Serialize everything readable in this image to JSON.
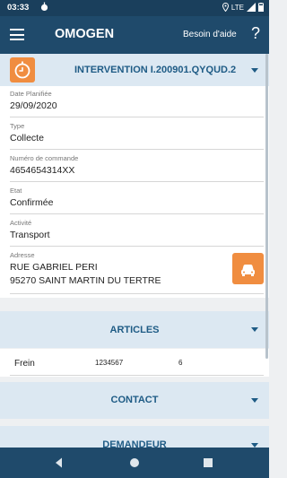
{
  "statusbar": {
    "time": "03:33",
    "network": "LTE"
  },
  "appbar": {
    "title": "OMOGEN",
    "help_label": "Besoin d'aide",
    "help_icon": "?"
  },
  "intervention": {
    "title": "INTERVENTION I.200901.QYQUD.2",
    "fields": [
      {
        "label": "Date Planifiée",
        "value": "29/09/2020"
      },
      {
        "label": "Type",
        "value": "Collecte"
      },
      {
        "label": "Numéro de commande",
        "value": "4654654314XX"
      },
      {
        "label": "Etat",
        "value": "Confirmée"
      },
      {
        "label": "Activité",
        "value": "Transport"
      },
      {
        "label": "Adresse",
        "value": "RUE GABRIEL PERI",
        "value2": "95270 SAINT MARTIN DU TERTRE"
      }
    ]
  },
  "articles": {
    "title": "ARTICLES",
    "rows": [
      {
        "name": "Frein",
        "code": "1234567",
        "qty": "6"
      }
    ]
  },
  "contact": {
    "title": "CONTACT"
  },
  "demandeur": {
    "title": "DEMANDEUR"
  },
  "colors": {
    "appbar": "#1f4a6b",
    "section_header": "#dce8f2",
    "accent_text": "#1e5b85",
    "orange": "#f08d40"
  },
  "icons": {
    "menu": "hamburger-menu-icon",
    "timer": "timer-icon",
    "car": "car-icon"
  }
}
